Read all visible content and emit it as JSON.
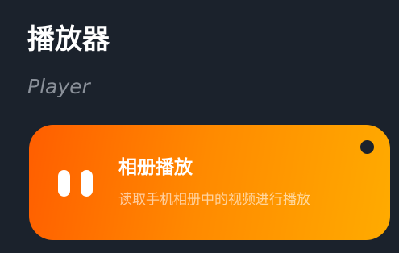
{
  "header": {
    "title": "播放器",
    "subtitle": "Player"
  },
  "card": {
    "title": "相册播放",
    "description": "读取手机相册中的视频进行播放",
    "icon": "pause-icon",
    "colors": {
      "gradient_start": "#ff5e00",
      "gradient_end": "#ffab00"
    }
  }
}
